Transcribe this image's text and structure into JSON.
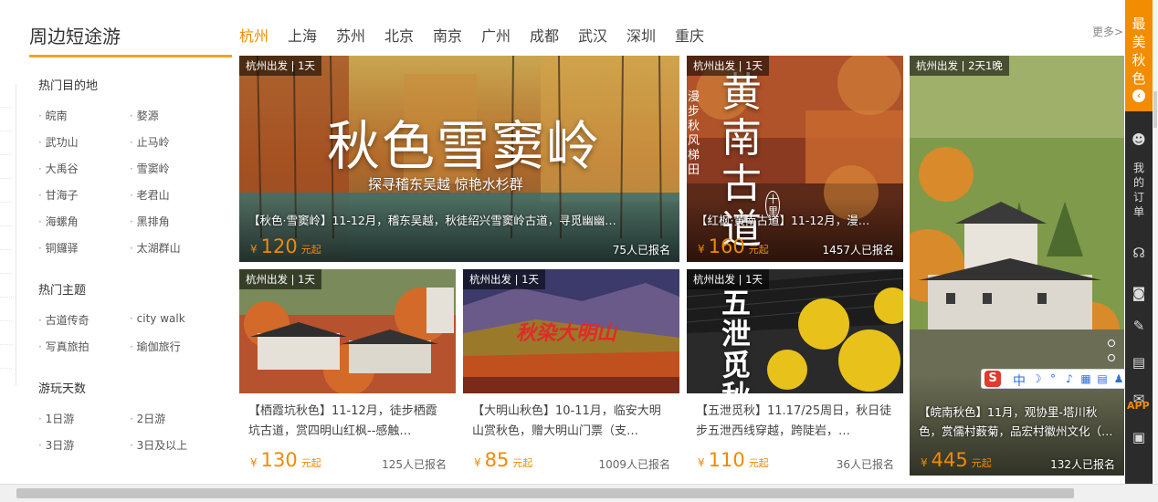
{
  "page_title": "周边短途游",
  "more_label": "更多>",
  "tabs": [
    {
      "label": "杭州",
      "active": true
    },
    {
      "label": "上海"
    },
    {
      "label": "苏州"
    },
    {
      "label": "北京"
    },
    {
      "label": "南京"
    },
    {
      "label": "广州"
    },
    {
      "label": "成都"
    },
    {
      "label": "武汉"
    },
    {
      "label": "深圳"
    },
    {
      "label": "重庆"
    }
  ],
  "sidebar": {
    "destinations": {
      "heading": "热门目的地",
      "items": [
        "皖南",
        "婺源",
        "武功山",
        "止马岭",
        "大禹谷",
        "雪窦岭",
        "甘海子",
        "老君山",
        "海螺角",
        "黑排角",
        "铜鑼驿",
        "太湖群山"
      ]
    },
    "themes": {
      "heading": "热门主题",
      "items": [
        "古道传奇",
        "city walk",
        "写真旅拍",
        "瑜伽旅行"
      ]
    },
    "days": {
      "heading": "游玩天数",
      "items": [
        "1日游",
        "2日游",
        "3日游",
        "3日及以上"
      ]
    }
  },
  "price_currency": "¥",
  "price_suffix": "元起",
  "cards": {
    "c1": {
      "tag": "杭州出发 | 1天",
      "banner_title": "秋色雪窦岭",
      "banner_sub": "探寻稽东吴越 惊艳水杉群",
      "title": "【秋色·雪窦岭】11-12月，稽东吴越，秋徒绍兴雪窦岭古道，寻觅幽幽…",
      "price": "120",
      "signed": "75人已报名"
    },
    "c2": {
      "tag": "杭州出发 | 1天",
      "banner_title": "黄南古道",
      "banner_side": "漫步秋风梯田",
      "banner_badge": "十里",
      "title": "【红枫·黄南古道】11-12月，漫…",
      "price": "160",
      "signed": "1457人已报名"
    },
    "c3": {
      "tag": "杭州出发 | 2天1晚",
      "title": "【皖南秋色】11月，观协里-塔川秋色，赏儒村薮菊，品宏村徽州文化（…",
      "price": "445",
      "signed": "132人已报名"
    },
    "c4": {
      "tag": "杭州出发 | 1天",
      "title": "【栖霞坑秋色】11-12月，徒步栖霞坑古道，赏四明山红枫--感触…",
      "price": "130",
      "signed": "125人已报名"
    },
    "c5": {
      "tag": "杭州出发 | 1天",
      "banner_title": "秋染大明山",
      "title": "【大明山秋色】10-11月，临安大明山赏秋色，赠大明山门票（支…",
      "price": "85",
      "signed": "1009人已报名"
    },
    "c6": {
      "tag": "杭州出发 | 1天",
      "banner_title": "五泄觅秋",
      "title": "【五泄觅秋】11.17/25周日，秋日徒步五泄西线穿越，跨陡岩，…",
      "price": "110",
      "signed": "36人已报名"
    }
  },
  "right_panel": {
    "banner": "最美秋色",
    "orders_label": "我的订单",
    "app_label": "APP"
  },
  "ime": {
    "logo": "S",
    "lang": "中"
  },
  "colors": {
    "accent": "#f08a00",
    "panel": "#2b2b2b",
    "rule": "#f2a51c"
  }
}
